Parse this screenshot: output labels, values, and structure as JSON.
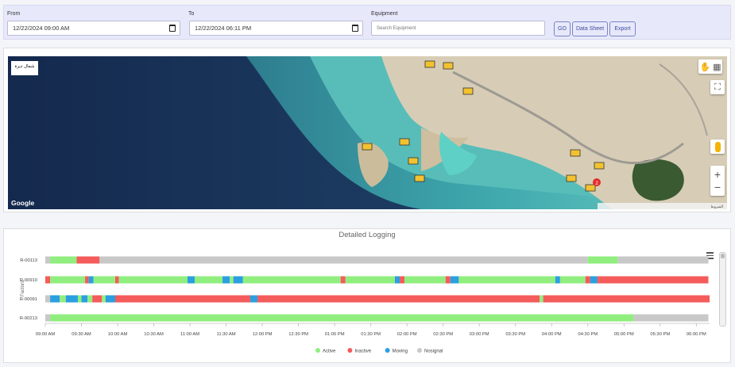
{
  "filters": {
    "from_label": "From",
    "from_value": "12/22/2024 09:00 AM",
    "to_label": "To",
    "to_value": "12/22/2024 06:11 PM",
    "equipment_label": "Equipment",
    "equipment_placeholder": "Search Equipment",
    "go_label": "GO",
    "datasheet_label": "Data Sheet",
    "export_label": "Export"
  },
  "map": {
    "google_logo": "Google",
    "corner_label": "شمال ديرة",
    "cluster_count": "2",
    "footer_text": "الشروط"
  },
  "chart_data": {
    "type": "timeline",
    "title": "Detailed Logging",
    "ylabel": "Factors",
    "x_ticks": [
      "09:00 AM",
      "09:30 AM",
      "10:00 AM",
      "10:30 AM",
      "11:00 AM",
      "11:30 AM",
      "12:00 PM",
      "12:30 PM",
      "01:00 PM",
      "01:30 PM",
      "02:00 PM",
      "02:30 PM",
      "03:00 PM",
      "03:30 PM",
      "04:00 PM",
      "04:30 PM",
      "05:00 PM",
      "05:30 PM",
      "06:00 PM"
    ],
    "x_range": [
      "09:00 AM",
      "06:11 PM"
    ],
    "legend_position": "bottom-center",
    "legend": [
      {
        "name": "Active",
        "color": "#90ee7e"
      },
      {
        "name": "Inactive",
        "color": "#f45b5b"
      },
      {
        "name": "Moving",
        "color": "#2b9fe0"
      },
      {
        "name": "Nosignal",
        "color": "#c8c8c8"
      }
    ],
    "rows": [
      {
        "name": "R-00113",
        "segments": [
          [
            "09:00",
            "09:04",
            "Nosignal"
          ],
          [
            "09:04",
            "09:26",
            "Active"
          ],
          [
            "09:26",
            "09:45",
            "Inactive"
          ],
          [
            "09:45",
            "04:30",
            "Nosignal"
          ],
          [
            "04:30",
            "04:55",
            "Active"
          ],
          [
            "04:55",
            "06:10",
            "Nosignal"
          ]
        ]
      },
      {
        "name": "R-00910",
        "segments": [
          [
            "09:00",
            "09:04",
            "Inactive"
          ],
          [
            "09:04",
            "09:33",
            "Active"
          ],
          [
            "09:33",
            "09:36",
            "Inactive"
          ],
          [
            "09:36",
            "09:40",
            "Moving"
          ],
          [
            "09:40",
            "09:58",
            "Active"
          ],
          [
            "09:58",
            "10:01",
            "Inactive"
          ],
          [
            "10:01",
            "10:58",
            "Active"
          ],
          [
            "10:58",
            "11:04",
            "Moving"
          ],
          [
            "11:04",
            "11:27",
            "Active"
          ],
          [
            "11:27",
            "11:33",
            "Moving"
          ],
          [
            "11:33",
            "11:36",
            "Active"
          ],
          [
            "11:36",
            "11:44",
            "Moving"
          ],
          [
            "11:44",
            "01:05",
            "Active"
          ],
          [
            "01:05",
            "01:09",
            "Inactive"
          ],
          [
            "01:09",
            "01:50",
            "Active"
          ],
          [
            "01:50",
            "01:54",
            "Moving"
          ],
          [
            "01:54",
            "01:58",
            "Inactive"
          ],
          [
            "01:58",
            "02:32",
            "Active"
          ],
          [
            "02:32",
            "02:36",
            "Inactive"
          ],
          [
            "02:36",
            "02:43",
            "Moving"
          ],
          [
            "02:43",
            "04:03",
            "Active"
          ],
          [
            "04:03",
            "04:07",
            "Moving"
          ],
          [
            "04:07",
            "04:28",
            "Active"
          ],
          [
            "04:28",
            "04:32",
            "Inactive"
          ],
          [
            "04:32",
            "04:38",
            "Moving"
          ],
          [
            "04:38",
            "04:40",
            "Inactive"
          ],
          [
            "04:40",
            "06:10",
            "Inactive"
          ]
        ]
      },
      {
        "name": "R-00091",
        "segments": [
          [
            "09:00",
            "09:04",
            "Nosignal"
          ],
          [
            "09:04",
            "09:12",
            "Moving"
          ],
          [
            "09:12",
            "09:17",
            "Active"
          ],
          [
            "09:17",
            "09:27",
            "Moving"
          ],
          [
            "09:27",
            "09:30",
            "Active"
          ],
          [
            "09:30",
            "09:35",
            "Moving"
          ],
          [
            "09:35",
            "09:39",
            "Active"
          ],
          [
            "09:39",
            "09:47",
            "Inactive"
          ],
          [
            "09:47",
            "09:50",
            "Active"
          ],
          [
            "09:50",
            "09:58",
            "Moving"
          ],
          [
            "09:58",
            "11:50",
            "Inactive"
          ],
          [
            "11:50",
            "11:56",
            "Moving"
          ],
          [
            "11:56",
            "03:50",
            "Inactive"
          ],
          [
            "03:50",
            "03:53",
            "Active"
          ],
          [
            "03:53",
            "06:11",
            "Inactive"
          ]
        ]
      },
      {
        "name": "R-00213",
        "segments": [
          [
            "09:00",
            "09:04",
            "Nosignal"
          ],
          [
            "09:04",
            "05:08",
            "Active"
          ],
          [
            "05:08",
            "06:10",
            "Nosignal"
          ]
        ]
      }
    ]
  }
}
